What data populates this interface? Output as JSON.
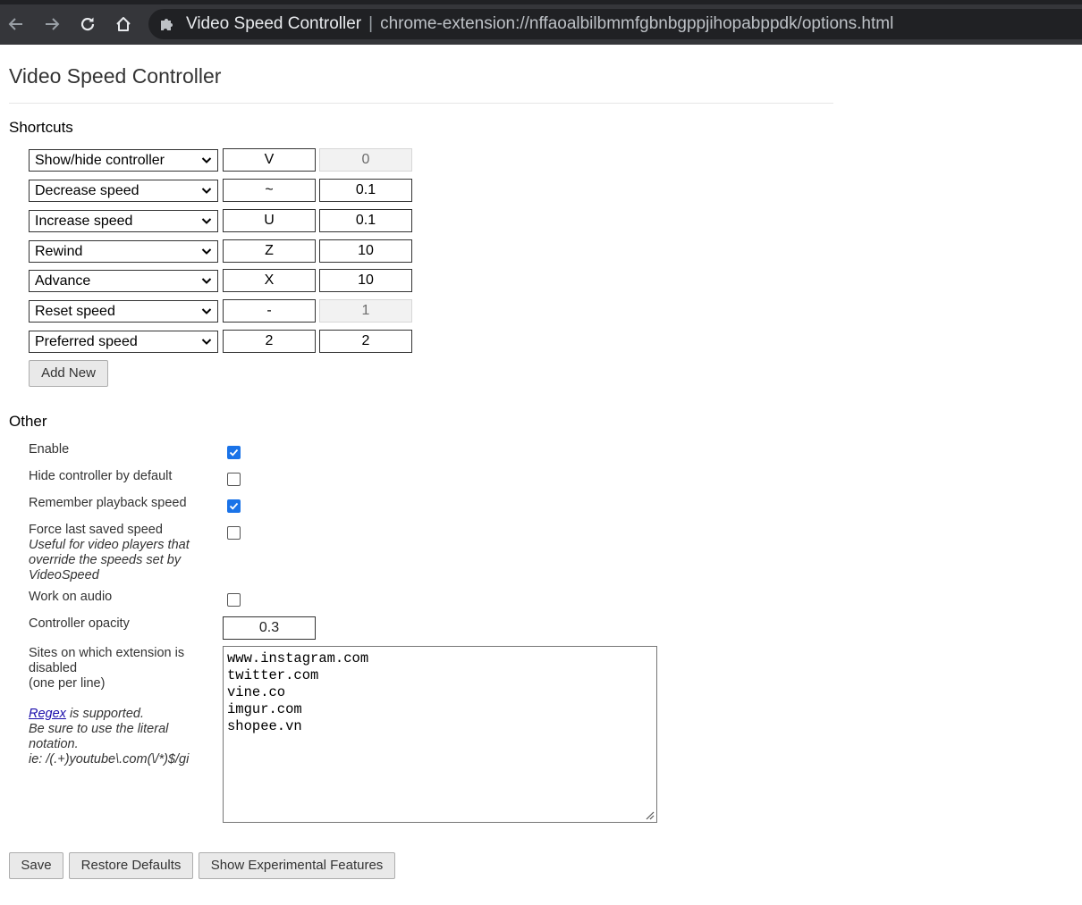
{
  "browser": {
    "tab_title": "Video Speed Controller",
    "separator": "|",
    "url": "chrome-extension://nffaoalbilbmmfgbnbgppjihopabppdk/options.html",
    "icons": {
      "back": "back-arrow-icon",
      "forward": "forward-arrow-icon",
      "reload": "reload-icon",
      "home": "home-icon",
      "extension": "puzzle-piece-icon"
    }
  },
  "page": {
    "title": "Video Speed Controller"
  },
  "shortcuts": {
    "title": "Shortcuts",
    "rows": [
      {
        "action": "Show/hide controller",
        "key": "V",
        "value": "0",
        "value_disabled": true
      },
      {
        "action": "Decrease speed",
        "key": "~",
        "value": "0.1",
        "value_disabled": false
      },
      {
        "action": "Increase speed",
        "key": "U",
        "value": "0.1",
        "value_disabled": false
      },
      {
        "action": "Rewind",
        "key": "Z",
        "value": "10",
        "value_disabled": false
      },
      {
        "action": "Advance",
        "key": "X",
        "value": "10",
        "value_disabled": false
      },
      {
        "action": "Reset speed",
        "key": "-",
        "value": "1",
        "value_disabled": true
      },
      {
        "action": "Preferred speed",
        "key": "2",
        "value": "2",
        "value_disabled": false
      }
    ],
    "add_new_label": "Add New"
  },
  "other": {
    "title": "Other",
    "enable_label": "Enable",
    "enable_checked": true,
    "hide_controller_label": "Hide controller by default",
    "hide_controller_checked": false,
    "remember_speed_label": "Remember playback speed",
    "remember_speed_checked": true,
    "force_speed_label": "Force last saved speed",
    "force_speed_note_1": "Useful for video players that",
    "force_speed_note_2": "override the speeds set by",
    "force_speed_note_3": "VideoSpeed",
    "force_speed_checked": false,
    "audio_label": "Work on audio",
    "audio_checked": false,
    "opacity_label": "Controller opacity",
    "opacity_value": "0.3",
    "sites_label_1": "Sites on which extension is",
    "sites_label_2": "disabled",
    "sites_label_3": "(one per line)",
    "regex_link": "Regex",
    "regex_supported": " is supported.",
    "regex_note_1": "Be sure to use the literal",
    "regex_note_2": "notation.",
    "regex_note_3": "ie: /(.+)youtube\\.com(\\/*)$/gi",
    "sites": [
      "www.instagram.com",
      "twitter.com",
      "vine.co",
      "imgur.com",
      "shopee.vn"
    ]
  },
  "footer": {
    "save_label": "Save",
    "restore_label": "Restore Defaults",
    "experimental_label": "Show Experimental Features"
  }
}
